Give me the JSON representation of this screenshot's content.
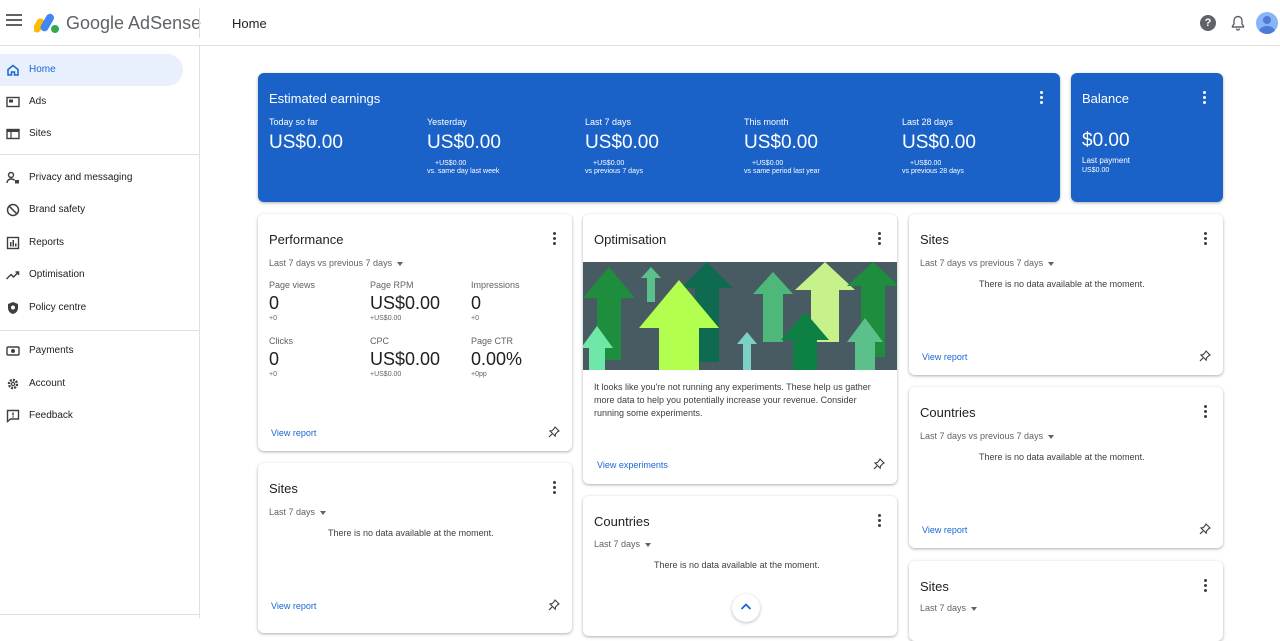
{
  "header": {
    "app_name": "Google AdSense",
    "page_title": "Home",
    "help_glyph": "?"
  },
  "sidebar": {
    "items": [
      {
        "label": "Home",
        "icon": "home-icon",
        "active": true
      },
      {
        "label": "Ads",
        "icon": "ads-icon"
      },
      {
        "label": "Sites",
        "icon": "sites-icon"
      },
      {
        "label": "Privacy and messaging",
        "icon": "privacy-icon"
      },
      {
        "label": "Brand safety",
        "icon": "block-icon"
      },
      {
        "label": "Reports",
        "icon": "reports-icon"
      },
      {
        "label": "Optimisation",
        "icon": "trending-icon"
      },
      {
        "label": "Policy centre",
        "icon": "shield-icon"
      },
      {
        "label": "Payments",
        "icon": "payments-icon"
      },
      {
        "label": "Account",
        "icon": "gear-icon"
      },
      {
        "label": "Feedback",
        "icon": "feedback-icon"
      }
    ]
  },
  "earnings": {
    "title": "Estimated earnings",
    "columns": [
      {
        "label": "Today so far",
        "value": "US$0.00",
        "delta": "",
        "comparison": ""
      },
      {
        "label": "Yesterday",
        "value": "US$0.00",
        "delta": "+US$0.00",
        "comparison": "vs. same day last week"
      },
      {
        "label": "Last 7 days",
        "value": "US$0.00",
        "delta": "+US$0.00",
        "comparison": "vs previous 7 days"
      },
      {
        "label": "This month",
        "value": "US$0.00",
        "delta": "+US$0.00",
        "comparison": "vs same period last year"
      },
      {
        "label": "Last 28 days",
        "value": "US$0.00",
        "delta": "+US$0.00",
        "comparison": "vs previous 28 days"
      }
    ]
  },
  "balance": {
    "title": "Balance",
    "value": "$0.00",
    "last_payment_label": "Last payment",
    "last_payment_value": "US$0.00"
  },
  "performance": {
    "title": "Performance",
    "range": "Last 7 days vs previous 7 days",
    "metrics": [
      {
        "label": "Page views",
        "value": "0",
        "delta": "+0"
      },
      {
        "label": "Page RPM",
        "value": "US$0.00",
        "delta": "+US$0.00"
      },
      {
        "label": "Impressions",
        "value": "0",
        "delta": "+0"
      },
      {
        "label": "Clicks",
        "value": "0",
        "delta": "+0"
      },
      {
        "label": "CPC",
        "value": "US$0.00",
        "delta": "+US$0.00"
      },
      {
        "label": "Page CTR",
        "value": "0.00%",
        "delta": "+0pp"
      }
    ],
    "link": "View report"
  },
  "optimisation": {
    "title": "Optimisation",
    "text": "It looks like you're not running any experiments. These help us gather more data to help you potentially increase your revenue. Consider running some experiments.",
    "link": "View experiments"
  },
  "sites_card": {
    "title": "Sites",
    "range": "Last 7 days vs previous 7 days",
    "nodata": "There is no data available at the moment.",
    "link": "View report"
  },
  "countries_card": {
    "title": "Countries",
    "range": "Last 7 days vs previous 7 days",
    "nodata": "There is no data available at the moment.",
    "link": "View report"
  },
  "sites_card_2": {
    "title": "Sites",
    "range": "Last 7 days",
    "nodata": "There is no data available at the moment.",
    "link": "View report"
  },
  "countries_card_2": {
    "title": "Countries",
    "range": "Last 7 days",
    "nodata": "There is no data available at the moment."
  },
  "sites_card_3": {
    "title": "Sites",
    "range": "Last 7 days"
  },
  "colors": {
    "brand_blue": "#1a62c7",
    "link_blue": "#1967d2",
    "active_bg": "#e8f0fe"
  }
}
